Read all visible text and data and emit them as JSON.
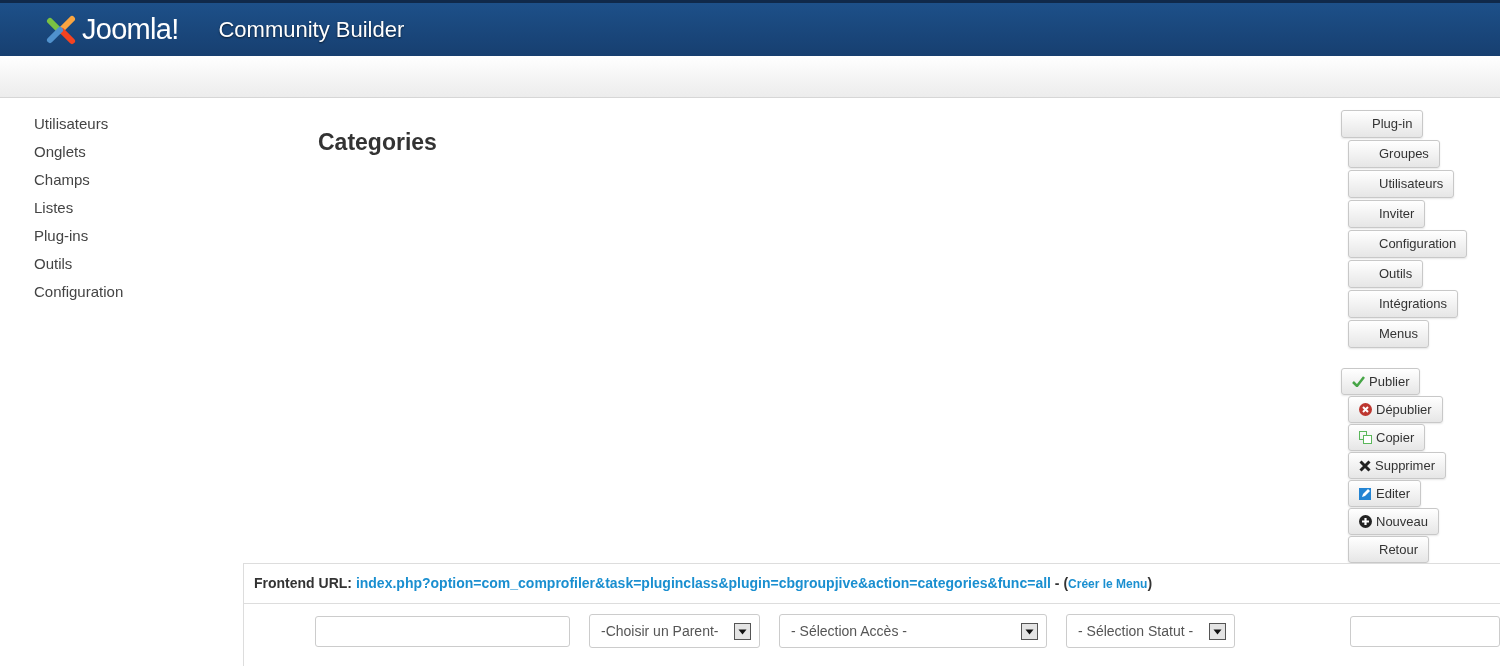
{
  "header": {
    "logo_text": "Joomla!",
    "title": "Community Builder"
  },
  "sidebar": {
    "items": [
      {
        "label": "Utilisateurs"
      },
      {
        "label": "Onglets"
      },
      {
        "label": "Champs"
      },
      {
        "label": "Listes"
      },
      {
        "label": "Plug-ins"
      },
      {
        "label": "Outils"
      },
      {
        "label": "Configuration"
      }
    ]
  },
  "page_title": "Categories",
  "menu_buttons": [
    {
      "label": "Plug-in"
    },
    {
      "label": "Groupes"
    },
    {
      "label": "Utilisateurs"
    },
    {
      "label": "Inviter"
    },
    {
      "label": "Configuration"
    },
    {
      "label": "Outils"
    },
    {
      "label": "Intégrations"
    },
    {
      "label": "Menus"
    }
  ],
  "action_buttons": [
    {
      "label": "Publier",
      "kind": "check"
    },
    {
      "label": "Dépublier",
      "kind": "cancel"
    },
    {
      "label": "Copier",
      "kind": "copy"
    },
    {
      "label": "Supprimer",
      "kind": "delete"
    },
    {
      "label": "Editer",
      "kind": "edit"
    },
    {
      "label": "Nouveau",
      "kind": "add"
    },
    {
      "label": "Retour",
      "kind": "plain"
    }
  ],
  "frontend_url": {
    "label": "Frontend URL:",
    "url": "index.php?option=com_comprofiler&task=pluginclass&plugin=cbgroupjive&action=categories&func=all",
    "separator": " - (",
    "menu_link": "Créer le Menu",
    "close": ")"
  },
  "filters": [
    {
      "kind": "text"
    },
    {
      "kind": "select",
      "value": "-Choisir un Parent-"
    },
    {
      "kind": "select",
      "value": "- Sélection Accès -"
    },
    {
      "kind": "select",
      "value": "- Sélection Statut -"
    },
    {
      "kind": "text"
    }
  ]
}
